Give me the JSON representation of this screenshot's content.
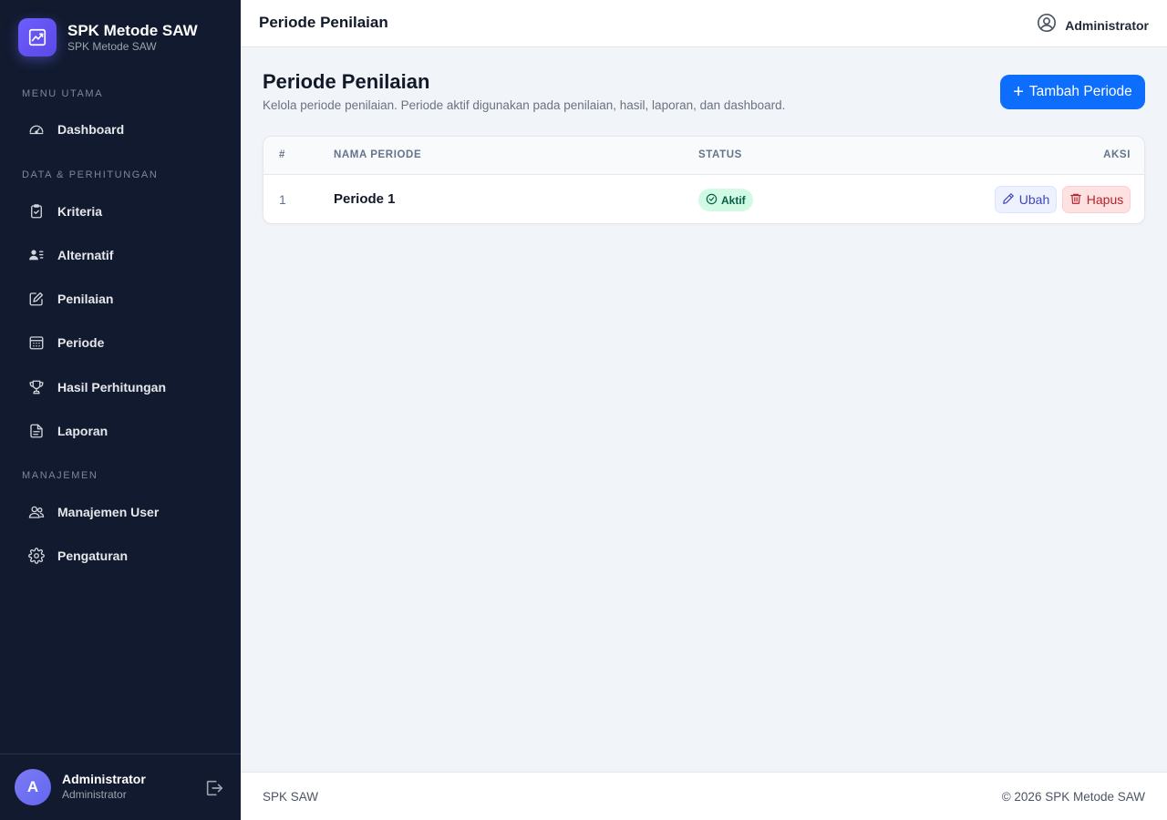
{
  "brand": {
    "title": "SPK Metode SAW",
    "subtitle": "SPK Metode SAW",
    "logo_icon": "chart-line-icon"
  },
  "sidebar": {
    "sections": [
      {
        "label": "MENU UTAMA"
      },
      {
        "label": "DATA & PERHITUNGAN"
      },
      {
        "label": "MANAJEMEN"
      }
    ],
    "items": [
      {
        "label": "Dashboard",
        "icon": "speedometer-icon"
      },
      {
        "label": "Kriteria",
        "icon": "clipboard-check-icon"
      },
      {
        "label": "Alternatif",
        "icon": "person-lines-icon"
      },
      {
        "label": "Penilaian",
        "icon": "pencil-square-icon"
      },
      {
        "label": "Periode",
        "icon": "calendar-icon"
      },
      {
        "label": "Hasil Perhitungan",
        "icon": "trophy-icon"
      },
      {
        "label": "Laporan",
        "icon": "file-text-icon"
      },
      {
        "label": "Manajemen User",
        "icon": "people-icon"
      },
      {
        "label": "Pengaturan",
        "icon": "gear-icon"
      }
    ],
    "user": {
      "avatar_letter": "A",
      "name": "Administrator",
      "role": "Administrator"
    }
  },
  "topbar": {
    "title": "Periode Penilaian",
    "user": "Administrator"
  },
  "main": {
    "title": "Periode Penilaian",
    "description": "Kelola periode penilaian. Periode aktif digunakan pada penilaian, hasil, laporan, dan dashboard.",
    "add_button": "Tambah Periode",
    "table": {
      "columns": [
        "#",
        "NAMA PERIODE",
        "STATUS",
        "AKSI"
      ],
      "rows": [
        {
          "no": "1",
          "name": "Periode 1",
          "status": "Aktif",
          "edit": "Ubah",
          "delete": "Hapus"
        }
      ]
    }
  },
  "footer": {
    "left": "SPK SAW",
    "right": "© 2026 SPK Metode SAW"
  },
  "colors": {
    "sidebar_bg": "#111a2e",
    "primary": "#0d6efd",
    "success_bg": "#d1fae5",
    "danger": "#b4232c",
    "brand": "#6d5dfc"
  }
}
